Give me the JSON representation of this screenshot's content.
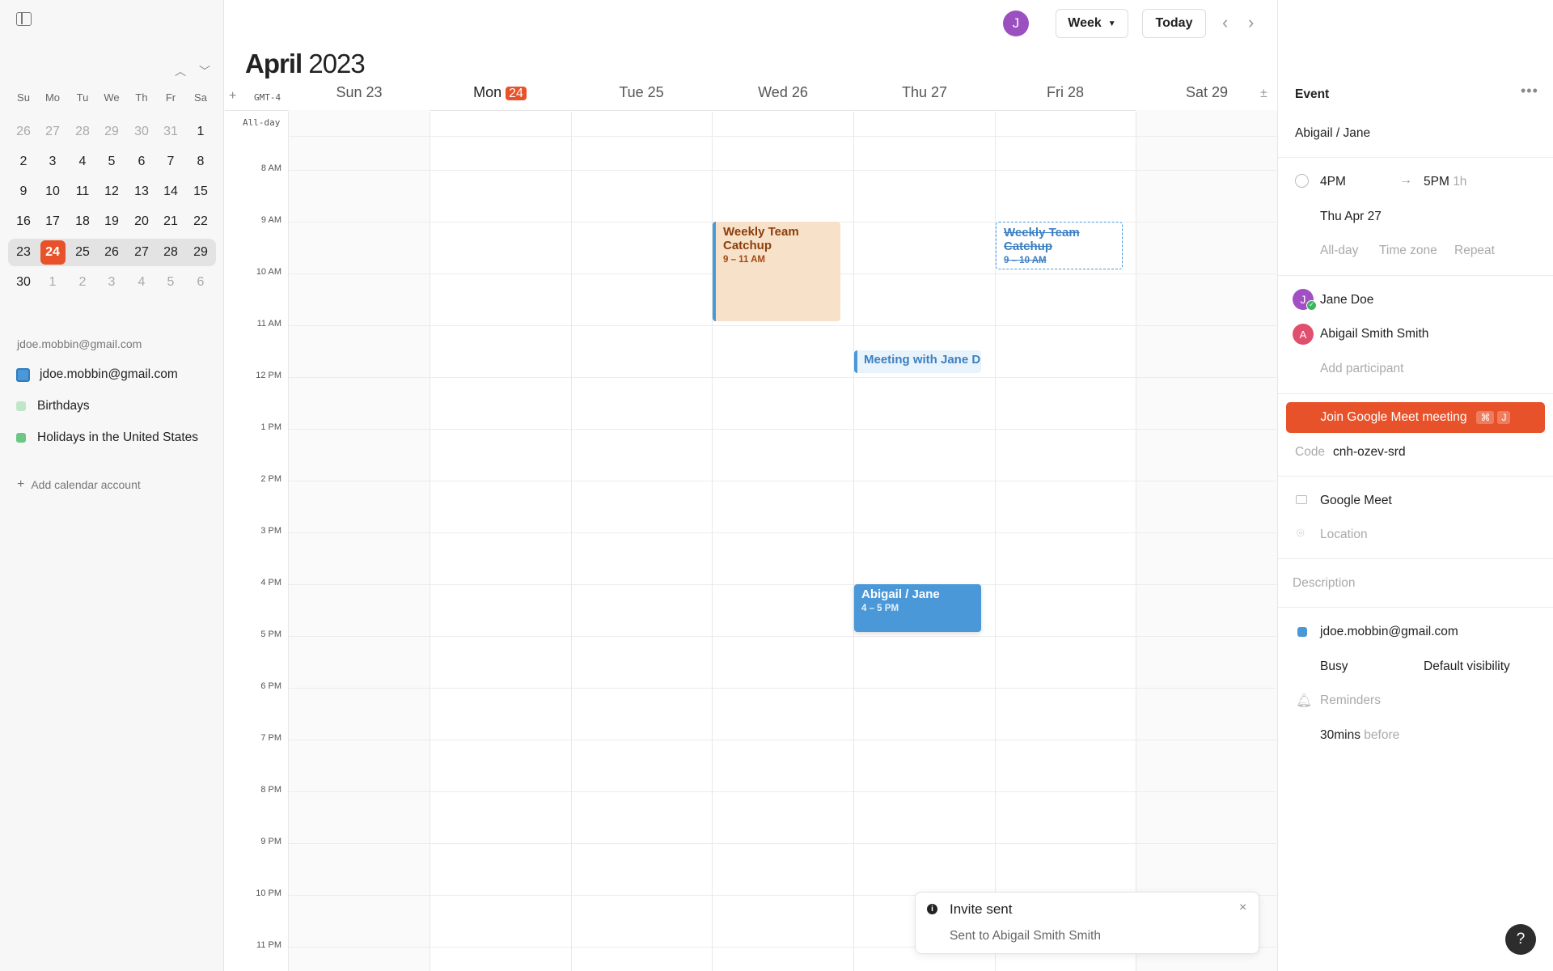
{
  "sidebar": {
    "mini_cal_headers": [
      "Su",
      "Mo",
      "Tu",
      "We",
      "Th",
      "Fr",
      "Sa"
    ],
    "mini_cal_rows": [
      [
        "26",
        "27",
        "28",
        "29",
        "30",
        "31",
        "1"
      ],
      [
        "2",
        "3",
        "4",
        "5",
        "6",
        "7",
        "8"
      ],
      [
        "9",
        "10",
        "11",
        "12",
        "13",
        "14",
        "15"
      ],
      [
        "16",
        "17",
        "18",
        "19",
        "20",
        "21",
        "22"
      ],
      [
        "23",
        "24",
        "25",
        "26",
        "27",
        "28",
        "29"
      ],
      [
        "30",
        "1",
        "2",
        "3",
        "4",
        "5",
        "6"
      ]
    ],
    "account_label": "jdoe.mobbin@gmail.com",
    "calendars": [
      {
        "label": "jdoe.mobbin@gmail.com",
        "color": "#4a98d8"
      },
      {
        "label": "Birthdays",
        "color": "#7cc98e"
      },
      {
        "label": "Holidays in the United States",
        "color": "#5fbf73"
      }
    ],
    "add_account": "Add calendar account"
  },
  "header": {
    "month": "April",
    "year": "2023",
    "avatar_initial": "J",
    "view_label": "Week",
    "today_label": "Today",
    "timezone": "GMT-4",
    "all_day_label": "All-day",
    "days": [
      "Sun 23",
      "Mon",
      "Tue 25",
      "Wed 26",
      "Thu 27",
      "Fri 28",
      "Sat 29"
    ],
    "today_badge": "24"
  },
  "hours": [
    "8 AM",
    "9 AM",
    "10 AM",
    "11 AM",
    "12 PM",
    "1 PM",
    "2 PM",
    "3 PM",
    "4 PM",
    "5 PM",
    "6 PM",
    "7 PM",
    "8 PM",
    "9 PM",
    "10 PM",
    "11 PM"
  ],
  "events": {
    "wed": {
      "title": "Weekly Team Catchup",
      "time": "9 – 11 AM"
    },
    "fri": {
      "title": "Weekly Team Catchup",
      "time": "9 – 10 AM"
    },
    "thu_meeting": {
      "title": "Meeting with Jane D"
    },
    "thu_abigail": {
      "title": "Abigail / Jane",
      "time": "4 – 5 PM"
    }
  },
  "panel": {
    "heading": "Event",
    "title": "Abigail / Jane",
    "start": "4PM",
    "end": "5PM",
    "duration": "1h",
    "date": "Thu Apr 27",
    "all_day": "All-day",
    "time_zone": "Time zone",
    "repeat": "Repeat",
    "participants": [
      {
        "name": "Jane Doe",
        "initial": "J",
        "color": "#a24fc4"
      },
      {
        "name": "Abigail Smith Smith",
        "initial": "A",
        "color": "#e0506e"
      }
    ],
    "add_participant": "Add participant",
    "join_button": "Join Google Meet meeting",
    "shortcut_key1": "⌘",
    "shortcut_key2": "J",
    "code_label": "Code",
    "code_value": "cnh-ozev-srd",
    "conference": "Google Meet",
    "location": "Location",
    "description": "Description",
    "calendar": "jdoe.mobbin@gmail.com",
    "busy": "Busy",
    "visibility": "Default visibility",
    "reminders": "Reminders",
    "reminder_value": "30",
    "reminder_unit": "mins",
    "reminder_suffix": "before"
  },
  "toast": {
    "title": "Invite sent",
    "body": "Sent to Abigail Smith Smith"
  },
  "help": "?"
}
